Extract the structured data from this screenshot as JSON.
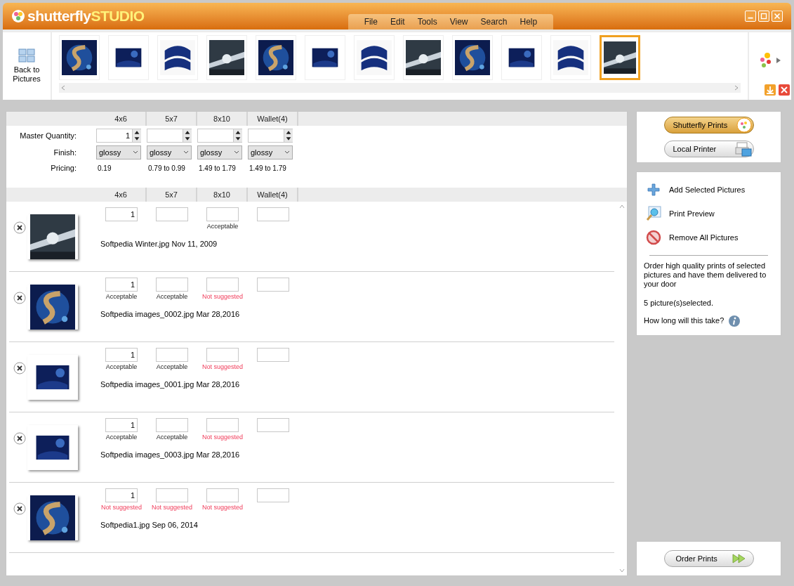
{
  "title_bar": {
    "brand": "shutterfly",
    "product": "STUDIO"
  },
  "menu": [
    "File",
    "Edit",
    "Tools",
    "View",
    "Search",
    "Help"
  ],
  "back_button": "Back to Pictures",
  "filmstrip": [
    {
      "selected": false
    },
    {
      "selected": false
    },
    {
      "selected": false
    },
    {
      "selected": false
    },
    {
      "selected": false
    },
    {
      "selected": false
    },
    {
      "selected": false
    },
    {
      "selected": false
    },
    {
      "selected": false
    },
    {
      "selected": false
    },
    {
      "selected": false
    },
    {
      "selected": true
    }
  ],
  "sizes": [
    "4x6",
    "5x7",
    "8x10",
    "Wallet(4)"
  ],
  "master": {
    "quantity_label": "Master Quantity:",
    "finish_label": "Finish:",
    "pricing_label": "Pricing:",
    "columns": [
      {
        "quantity": "1",
        "finish": "glossy",
        "price": "0.19"
      },
      {
        "finish": "glossy",
        "price": "0.79 to 0.99"
      },
      {
        "finish": "glossy",
        "price": "1.49 to 1.79"
      },
      {
        "finish": "glossy",
        "price": "1.49 to 1.79"
      }
    ]
  },
  "items_sizes": [
    "4x6",
    "5x7",
    "8x10",
    "Wallet(4)"
  ],
  "items": [
    {
      "file": "Softpedia Winter.jpg Nov 11, 2009",
      "quantity": "1",
      "notes": [
        {
          "kind": "blank"
        },
        {
          "kind": "blank"
        },
        {
          "kind": "note",
          "text": "Acceptable",
          "suggested": true
        },
        {
          "kind": "blank"
        }
      ]
    },
    {
      "file": "Softpedia images_0002.jpg Mar 28,2016",
      "quantity": "1",
      "notes": [
        {
          "kind": "note",
          "text": "Acceptable",
          "suggested": true
        },
        {
          "kind": "note",
          "text": "Acceptable",
          "suggested": true
        },
        {
          "kind": "note",
          "text": "Not suggested",
          "suggested": false
        },
        {
          "kind": "blank"
        }
      ]
    },
    {
      "file": "Softpedia images_0001.jpg Mar 28,2016",
      "quantity": "1",
      "notes": [
        {
          "kind": "note",
          "text": "Acceptable",
          "suggested": true
        },
        {
          "kind": "note",
          "text": "Acceptable",
          "suggested": true
        },
        {
          "kind": "note",
          "text": "Not suggested",
          "suggested": false
        },
        {
          "kind": "blank"
        }
      ]
    },
    {
      "file": "Softpedia images_0003.jpg Mar 28,2016",
      "quantity": "1",
      "notes": [
        {
          "kind": "note",
          "text": "Acceptable",
          "suggested": true
        },
        {
          "kind": "note",
          "text": "Acceptable",
          "suggested": true
        },
        {
          "kind": "note",
          "text": "Not suggested",
          "suggested": false
        },
        {
          "kind": "blank"
        }
      ]
    },
    {
      "file": "Softpedia1.jpg Sep 06, 2014",
      "quantity": "1",
      "notes": [
        {
          "kind": "note",
          "text": "Not suggested",
          "suggested": false
        },
        {
          "kind": "note",
          "text": "Not suggested",
          "suggested": false
        },
        {
          "kind": "note",
          "text": "Not suggested",
          "suggested": false
        },
        {
          "kind": "blank"
        }
      ]
    }
  ],
  "print_options": [
    {
      "label": "Shutterfly Prints",
      "selected": true
    },
    {
      "label": "Local Printer",
      "selected": false
    }
  ],
  "actions": [
    {
      "label": "Add Selected Pictures",
      "kind": "add"
    },
    {
      "label": "Print Preview",
      "kind": "preview"
    },
    {
      "label": "Remove All Pictures",
      "kind": "remove"
    }
  ],
  "description": "Order high quality prints of selected pictures and have them delivered to your door",
  "selection_count": "5 picture(s)selected.",
  "help_question": "How long will this take?",
  "order_button": "Order Prints"
}
